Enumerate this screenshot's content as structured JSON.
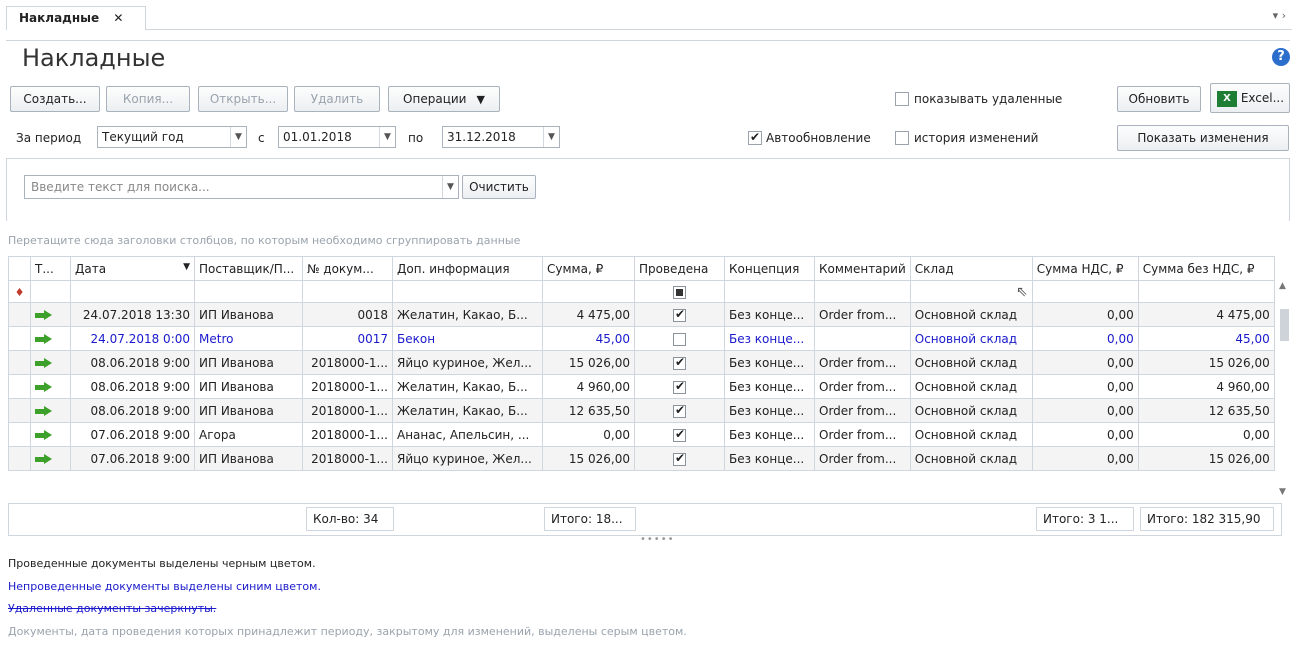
{
  "tab": {
    "title": "Накладные",
    "close": "✕",
    "menu": "▾ ›"
  },
  "page": {
    "title": "Накладные",
    "help": "?"
  },
  "toolbar": {
    "create": "Создать...",
    "copy": "Копия...",
    "open": "Открыть...",
    "delete": "Удалить",
    "operations": "Операции",
    "show_deleted": "показывать удаленные",
    "refresh": "Обновить",
    "excel": "Excel..."
  },
  "period": {
    "label": "За период",
    "value": "Текущий год",
    "from_label": "с",
    "from": "01.01.2018",
    "to_label": "по",
    "to": "31.12.2018",
    "autoupdate": "Автообновление",
    "history": "история изменений",
    "show_changes": "Показать изменения"
  },
  "search": {
    "placeholder": "Введите текст для поиска...",
    "clear": "Очистить"
  },
  "group_hint": "Перетащите сюда заголовки столбцов, по которым необходимо сгруппировать данные",
  "columns": [
    "Т...",
    "Дата",
    "Поставщик/П...",
    "№ докум...",
    "Доп. информация",
    "Сумма, ₽",
    "Проведена",
    "Концепция",
    "Комментарий",
    "Склад",
    "Сумма НДС, ₽",
    "Сумма без НДС, ₽"
  ],
  "rows": [
    {
      "date": "24.07.2018 13:30",
      "supplier": "ИП Иванова",
      "num": "0018",
      "info": "Желатин, Какао, Б...",
      "sum": "4 475,00",
      "posted": true,
      "concept": "Без конце...",
      "comment": "Order from...",
      "store": "Основной склад",
      "vat": "0,00",
      "novat": "4 475,00",
      "blue": false
    },
    {
      "date": "24.07.2018 0:00",
      "supplier": "Metro",
      "num": "0017",
      "info": "Бекон",
      "sum": "45,00",
      "posted": false,
      "concept": "Без конце...",
      "comment": "",
      "store": "Основной склад",
      "vat": "0,00",
      "novat": "45,00",
      "blue": true
    },
    {
      "date": "08.06.2018 9:00",
      "supplier": "ИП Иванова",
      "num": "2018000-1...",
      "info": "Яйцо куриное, Жел...",
      "sum": "15 026,00",
      "posted": true,
      "concept": "Без конце...",
      "comment": "Order from...",
      "store": "Основной склад",
      "vat": "0,00",
      "novat": "15 026,00",
      "blue": false
    },
    {
      "date": "08.06.2018 9:00",
      "supplier": "ИП Иванова",
      "num": "2018000-1...",
      "info": "Желатин, Какао, Б...",
      "sum": "4 960,00",
      "posted": true,
      "concept": "Без конце...",
      "comment": "Order from...",
      "store": "Основной склад",
      "vat": "0,00",
      "novat": "4 960,00",
      "blue": false
    },
    {
      "date": "08.06.2018 9:00",
      "supplier": "ИП Иванова",
      "num": "2018000-1...",
      "info": "Желатин, Какао, Б...",
      "sum": "12 635,50",
      "posted": true,
      "concept": "Без конце...",
      "comment": "Order from...",
      "store": "Основной склад",
      "vat": "0,00",
      "novat": "12 635,50",
      "blue": false
    },
    {
      "date": "07.06.2018 9:00",
      "supplier": "Агора",
      "num": "2018000-1...",
      "info": "Ананас, Апельсин, ...",
      "sum": "0,00",
      "posted": true,
      "concept": "Без конце...",
      "comment": "Order from...",
      "store": "Основной склад",
      "vat": "0,00",
      "novat": "0,00",
      "blue": false
    },
    {
      "date": "07.06.2018 9:00",
      "supplier": "ИП Иванова",
      "num": "2018000-1...",
      "info": "Яйцо куриное, Жел...",
      "sum": "15 026,00",
      "posted": true,
      "concept": "Без конце...",
      "comment": "Order from...",
      "store": "Основной склад",
      "vat": "0,00",
      "novat": "15 026,00",
      "blue": false
    }
  ],
  "totals": {
    "count": "Кол-во: 34",
    "sum": "Итого: 18...",
    "vat": "Итого: 3 1...",
    "novat": "Итого: 182 315,90"
  },
  "splitter": "•••••",
  "legend": {
    "black": "Проведенные документы выделены черным цветом.",
    "blue": "Непроведенные документы выделены синим цветом.",
    "deleted": "Удаленные документы зачеркнуты.",
    "gray": "Документы, дата проведения которых принадлежит периоду, закрытому для изменений, выделены серым цветом."
  },
  "colors": {
    "blue": "#1a1acc",
    "gray": "#9aa3ad",
    "accent": "#2c6ecb",
    "arrow": "#3ca02a"
  }
}
